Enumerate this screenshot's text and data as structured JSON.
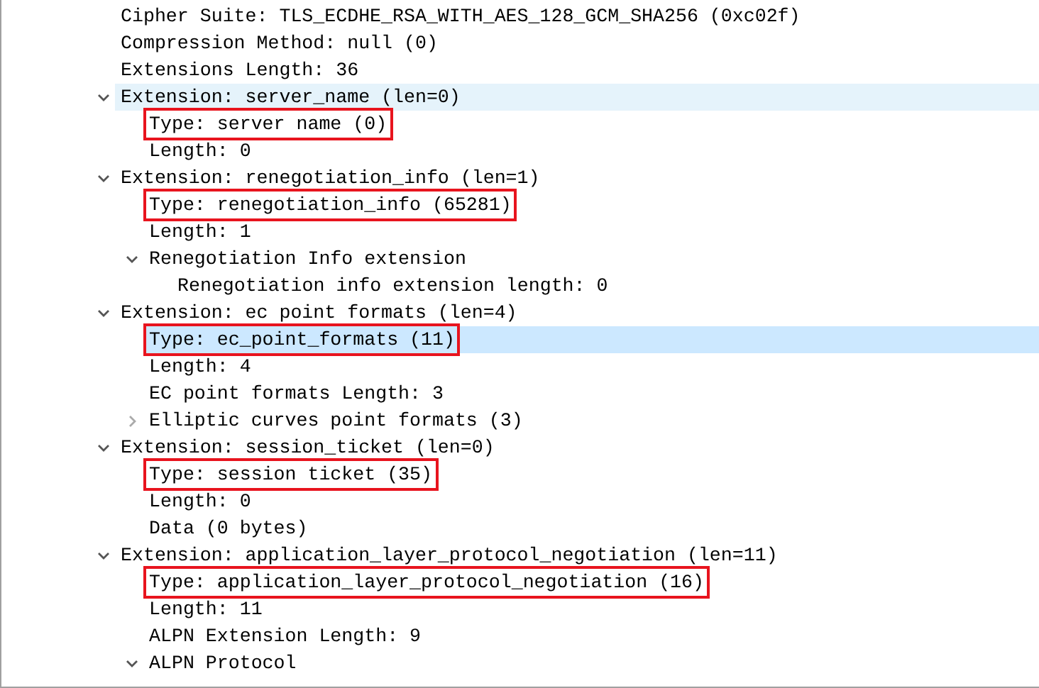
{
  "tree": [
    {
      "label": "Cipher Suite: TLS_ECDHE_RSA_WITH_AES_128_GCM_SHA256 (0xc02f)",
      "selected": false,
      "hovered": false,
      "boxed": false
    },
    {
      "label": "Compression Method: null (0)",
      "selected": false,
      "hovered": false,
      "boxed": false
    },
    {
      "label": "Extensions Length: 36",
      "selected": false,
      "hovered": false,
      "boxed": false
    },
    {
      "label": "Extension: server_name (len=0)",
      "expanded": true,
      "selected": false,
      "hovered": true,
      "boxed": false,
      "children": [
        {
          "label": "Type: server name (0)",
          "selected": false,
          "hovered": false,
          "boxed": true
        },
        {
          "label": "Length: 0",
          "selected": false,
          "hovered": false,
          "boxed": false
        }
      ]
    },
    {
      "label": "Extension: renegotiation_info (len=1)",
      "expanded": true,
      "selected": false,
      "hovered": false,
      "boxed": false,
      "children": [
        {
          "label": "Type: renegotiation_info (65281)",
          "selected": false,
          "hovered": false,
          "boxed": true
        },
        {
          "label": "Length: 1",
          "selected": false,
          "hovered": false,
          "boxed": false
        },
        {
          "label": "Renegotiation Info extension",
          "expanded": true,
          "selected": false,
          "hovered": false,
          "boxed": false,
          "children": [
            {
              "label": "Renegotiation info extension length: 0",
              "selected": false,
              "hovered": false,
              "boxed": false
            }
          ]
        }
      ]
    },
    {
      "label": "Extension: ec point formats (len=4)",
      "expanded": true,
      "selected": false,
      "hovered": false,
      "boxed": false,
      "children": [
        {
          "label": "Type: ec_point_formats (11)",
          "selected": true,
          "hovered": false,
          "boxed": true
        },
        {
          "label": "Length: 4",
          "selected": false,
          "hovered": false,
          "boxed": false
        },
        {
          "label": "EC point formats Length: 3",
          "selected": false,
          "hovered": false,
          "boxed": false
        },
        {
          "label": "Elliptic curves point formats (3)",
          "expanded": false,
          "selected": false,
          "hovered": false,
          "boxed": false
        }
      ]
    },
    {
      "label": "Extension: session_ticket (len=0)",
      "expanded": true,
      "selected": false,
      "hovered": false,
      "boxed": false,
      "children": [
        {
          "label": "Type: session ticket (35)",
          "selected": false,
          "hovered": false,
          "boxed": true
        },
        {
          "label": "Length: 0",
          "selected": false,
          "hovered": false,
          "boxed": false
        },
        {
          "label": "Data (0 bytes)",
          "selected": false,
          "hovered": false,
          "boxed": false
        }
      ]
    },
    {
      "label": "Extension: application_layer_protocol_negotiation (len=11)",
      "expanded": true,
      "selected": false,
      "hovered": false,
      "boxed": false,
      "children": [
        {
          "label": "Type: application_layer_protocol_negotiation (16)",
          "selected": false,
          "hovered": false,
          "boxed": true
        },
        {
          "label": "Length: 11",
          "selected": false,
          "hovered": false,
          "boxed": false
        },
        {
          "label": "ALPN Extension Length: 9",
          "selected": false,
          "hovered": false,
          "boxed": false
        },
        {
          "label": "ALPN Protocol",
          "expanded": true,
          "selected": false,
          "hovered": false,
          "boxed": false
        }
      ]
    }
  ]
}
